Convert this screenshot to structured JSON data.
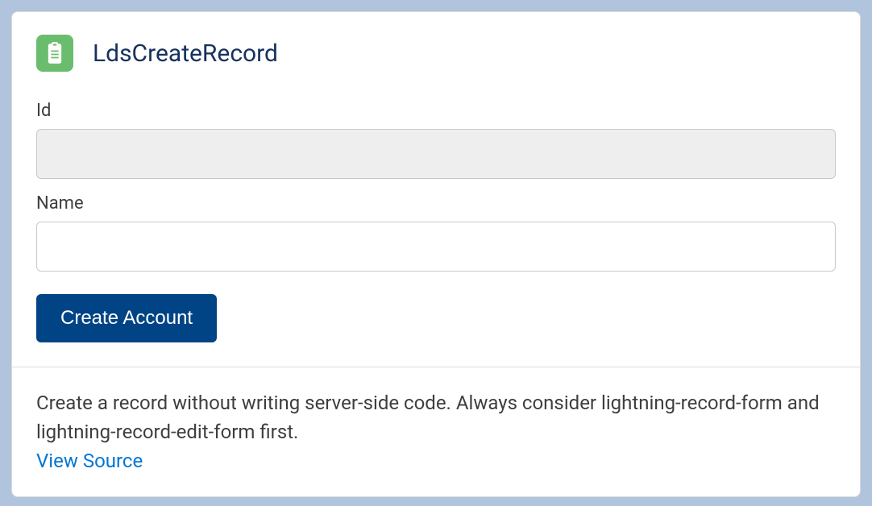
{
  "header": {
    "title": "LdsCreateRecord",
    "icon": "clipboard-icon"
  },
  "form": {
    "fields": [
      {
        "label": "Id",
        "value": "",
        "disabled": true
      },
      {
        "label": "Name",
        "value": "",
        "disabled": false
      }
    ],
    "submit_label": "Create Account"
  },
  "footer": {
    "description": "Create a record without writing server-side code. Always consider lightning-record-form and lightning-record-edit-form first.",
    "link_label": "View Source"
  }
}
